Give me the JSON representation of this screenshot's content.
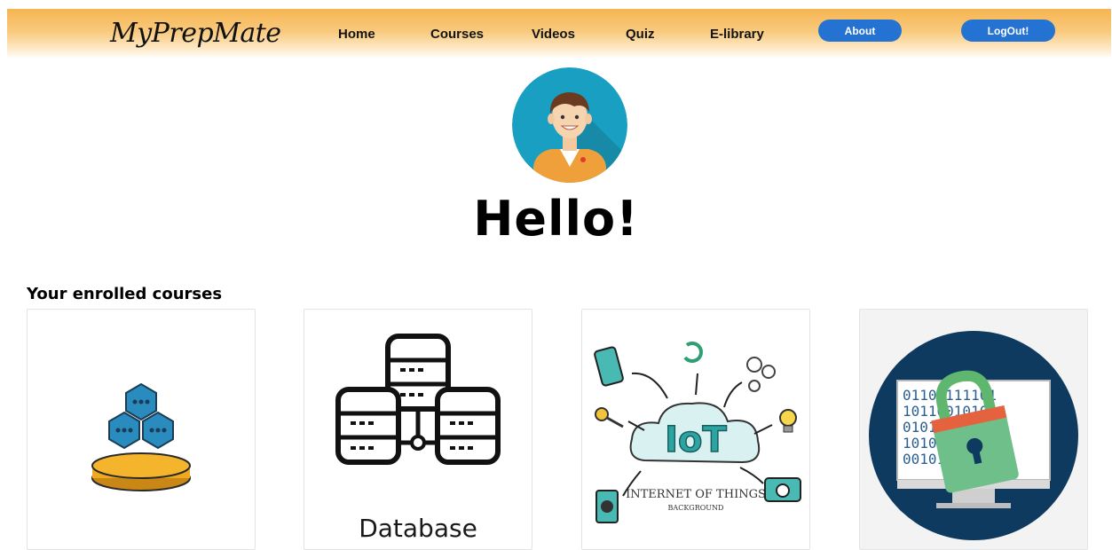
{
  "nav": {
    "brand": "MyPrepMate",
    "links": [
      "Home",
      "Courses",
      "Videos",
      "Quiz",
      "E-library"
    ],
    "about_label": "About",
    "logout_label": "LogOut!"
  },
  "profile": {
    "greeting": "Hello!"
  },
  "courses": {
    "section_title": "Your enrolled courses",
    "cards": [
      {
        "icon": "blockchain-icon"
      },
      {
        "icon": "database-icon",
        "caption": "Database"
      },
      {
        "icon": "iot-icon",
        "art_title": "IoT",
        "art_subtitle": "INTERNET OF THINGS",
        "art_tag": "BACKGROUND"
      },
      {
        "icon": "security-lock-icon",
        "binary": [
          "01100111101",
          "10110010101",
          "01010011010",
          "10101100101",
          "00101011001"
        ]
      }
    ]
  },
  "colors": {
    "button": "#2473d2",
    "nav_gradient_top": "#f6b552",
    "avatar_bg": "#199fc1"
  }
}
